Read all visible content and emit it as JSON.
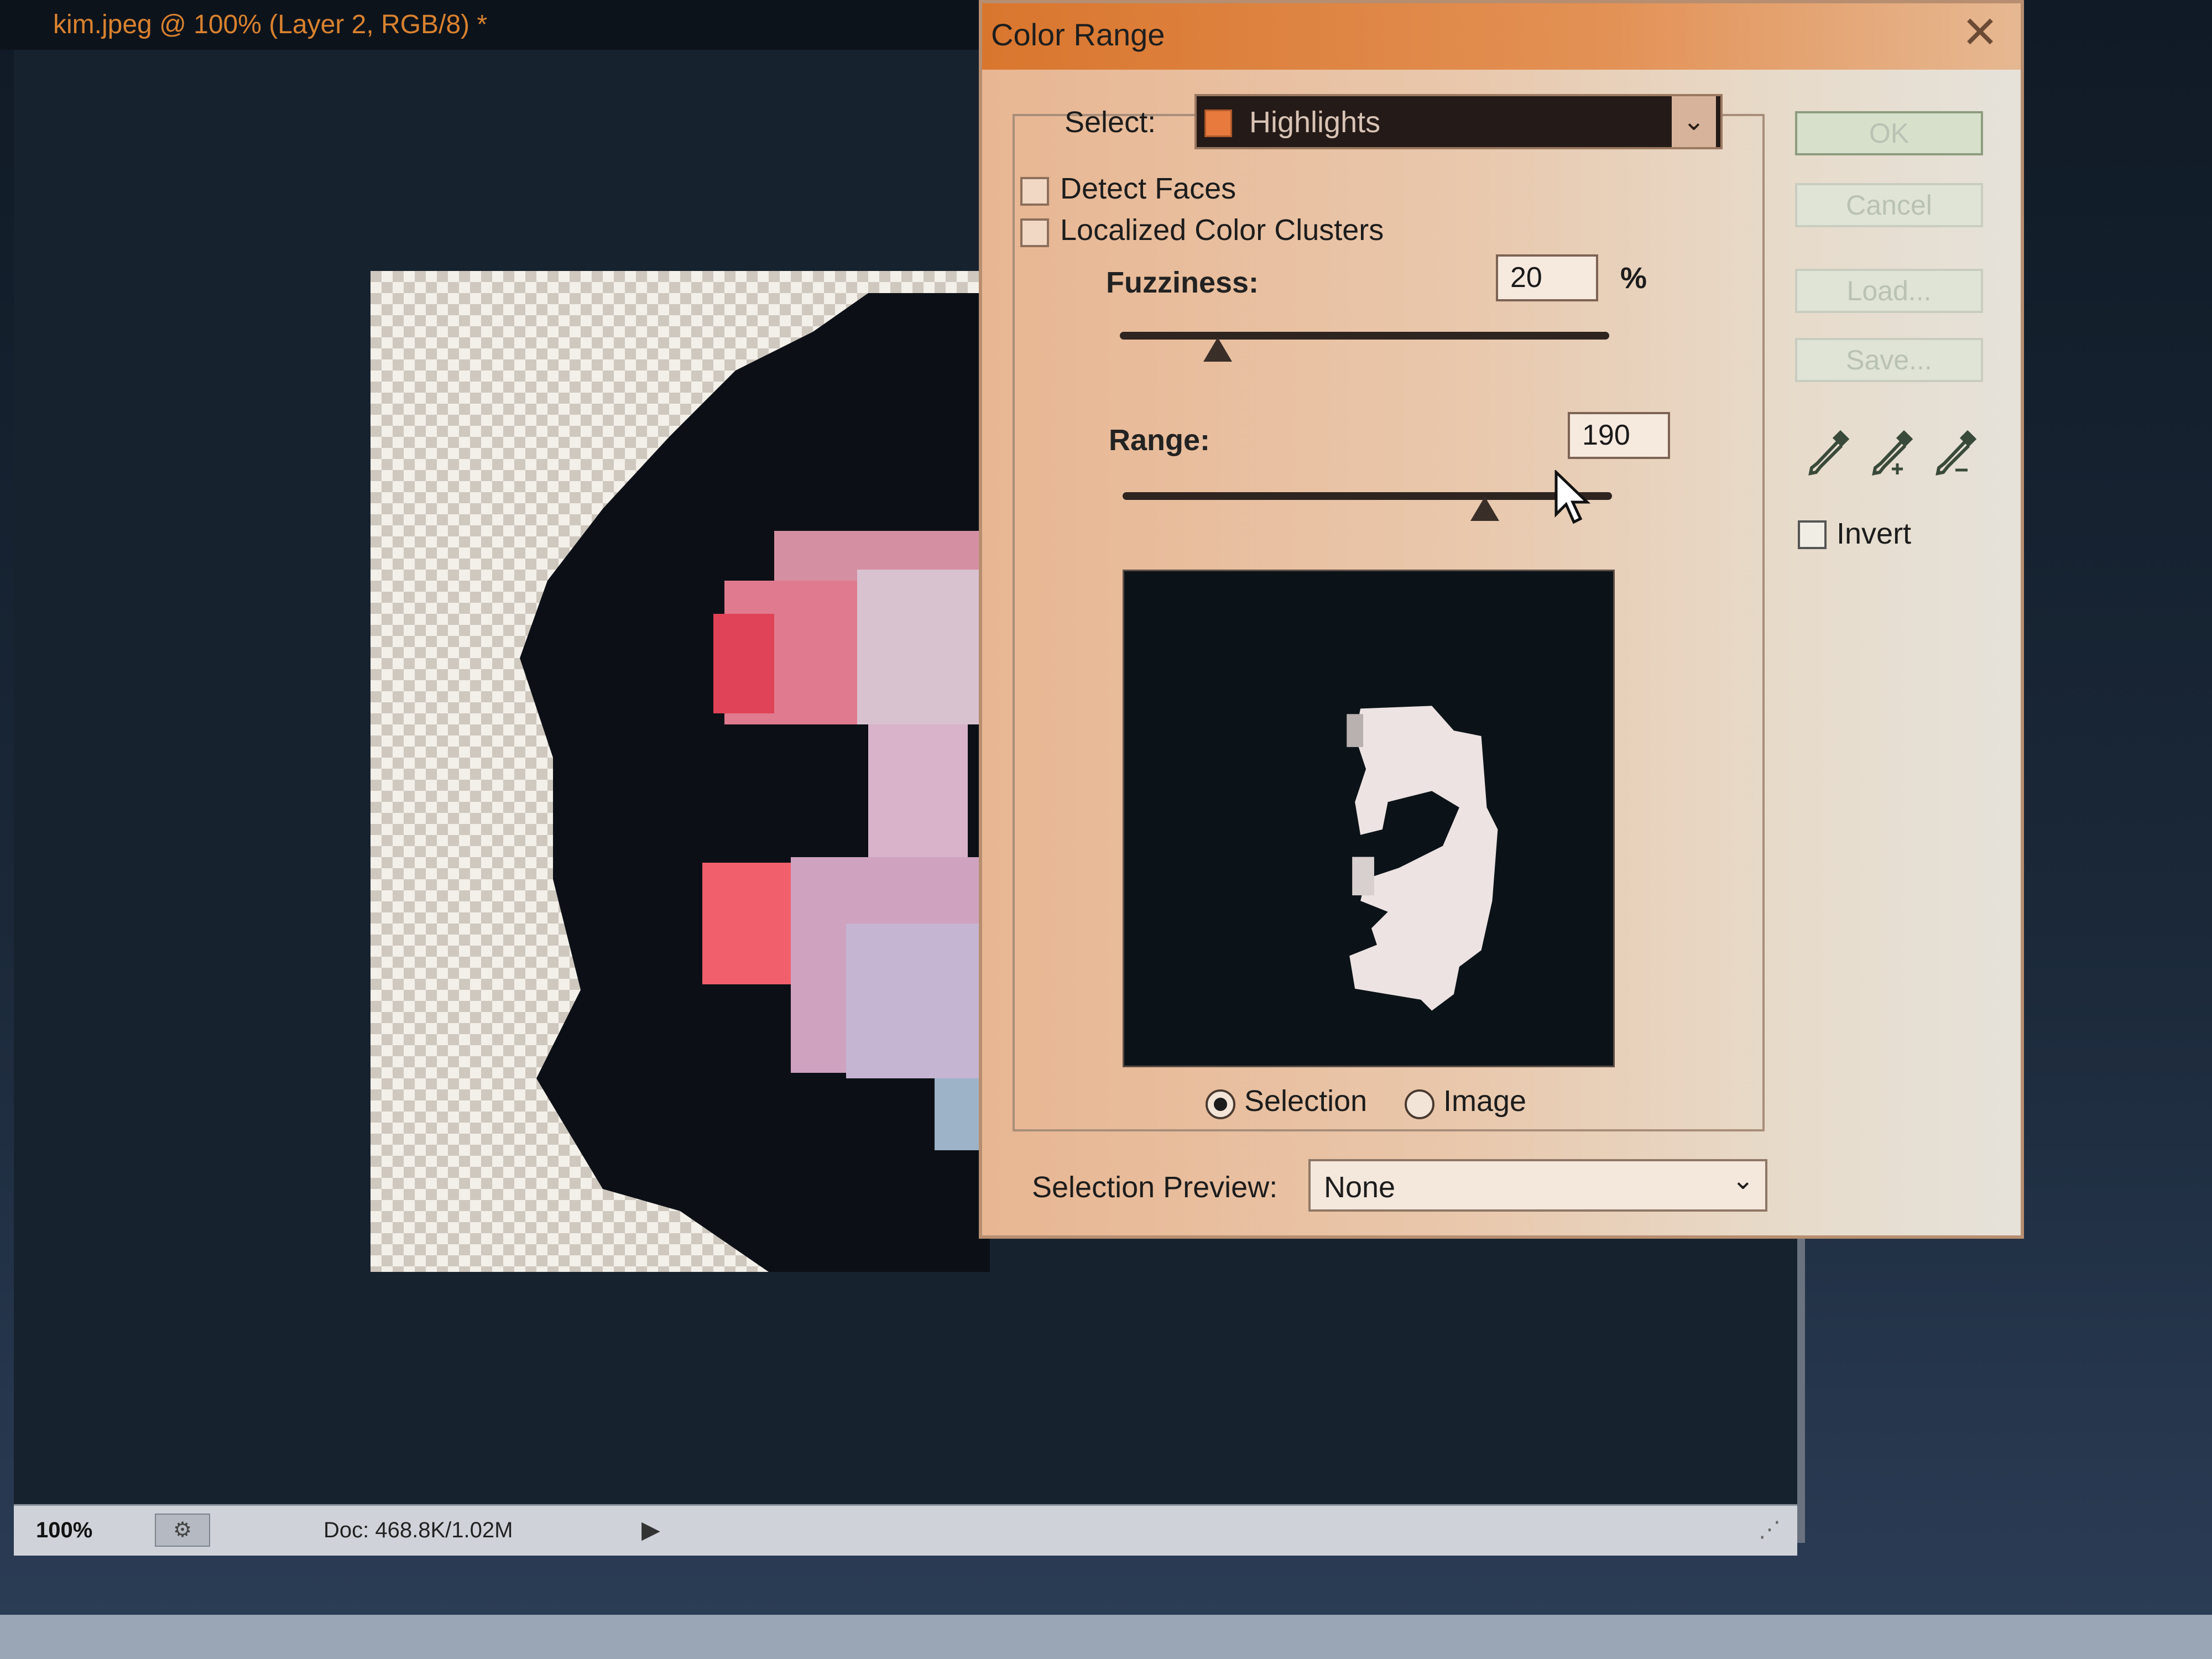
{
  "document": {
    "tab_title": "kim.jpeg @ 100% (Layer 2, RGB/8) *",
    "zoom": "100%",
    "doc_info": "Doc: 468.8K/1.02M"
  },
  "dialog": {
    "title": "Color Range",
    "select_label": "Select:",
    "select_value": "Highlights",
    "detect_faces_label": "Detect Faces",
    "localized_clusters_label": "Localized Color Clusters",
    "fuzziness_label": "Fuzziness:",
    "fuzziness_value": "20",
    "fuzziness_unit": "%",
    "fuzziness_slider_fraction": 0.2,
    "range_label": "Range:",
    "range_value": "190",
    "range_slider_fraction": 0.74,
    "radio_selection_label": "Selection",
    "radio_image_label": "Image",
    "selection_preview_label": "Selection Preview:",
    "selection_preview_value": "None",
    "buttons": {
      "ok": "OK",
      "cancel": "Cancel",
      "load": "Load...",
      "save": "Save..."
    },
    "invert_label": "Invert"
  },
  "icons": {
    "close": "close-icon",
    "eyedropper": "eyedropper-icon",
    "eyedropper_plus": "eyedropper-plus-icon",
    "eyedropper_minus": "eyedropper-minus-icon"
  },
  "colors": {
    "title_bar": "#d9762e",
    "highlight_swatch": "#e87a3e"
  }
}
